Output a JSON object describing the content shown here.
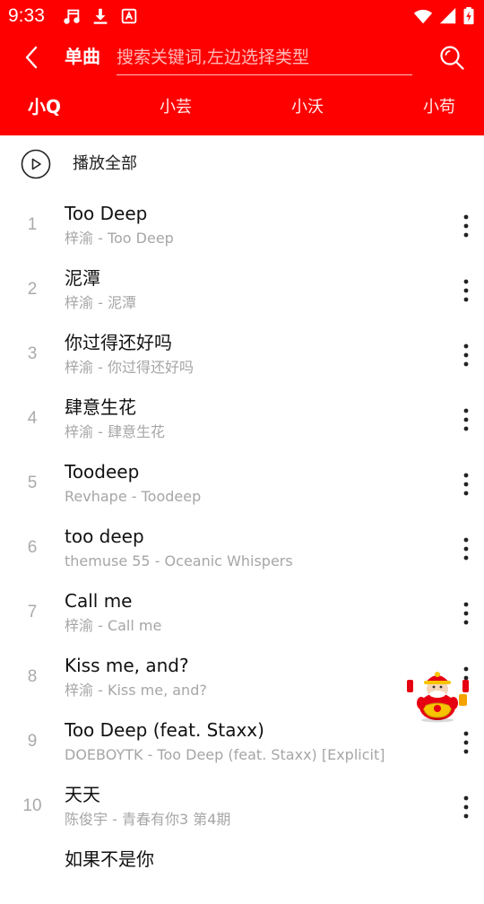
{
  "colors": {
    "primary": "#ff0000",
    "on_primary": "#ffffff",
    "text_primary": "#111111",
    "text_secondary": "#a6a6a6",
    "index_text": "#aaaaaa"
  },
  "status_bar": {
    "time": "9:33",
    "icons": [
      "music-note-icon",
      "download-icon",
      "app-badge-icon",
      "wifi-icon",
      "cellular-signal-icon",
      "battery-icon"
    ]
  },
  "toolbar": {
    "back_icon": "chevron-left-icon",
    "title": "单曲",
    "search_placeholder": "搜索关键词,左边选择类型",
    "search_icon": "search-icon"
  },
  "tabs": [
    {
      "label": "小Q",
      "active": true
    },
    {
      "label": "小芸",
      "active": false
    },
    {
      "label": "小沃",
      "active": false
    },
    {
      "label": "小苟",
      "active": false
    }
  ],
  "play_all": {
    "icon": "play-circle-icon",
    "label": "播放全部"
  },
  "songs": [
    {
      "index": "1",
      "title": "Too Deep",
      "subtitle": "梓渝 - Too Deep"
    },
    {
      "index": "2",
      "title": "泥潭",
      "subtitle": "梓渝 - 泥潭"
    },
    {
      "index": "3",
      "title": "你过得还好吗",
      "subtitle": "梓渝 - 你过得还好吗"
    },
    {
      "index": "4",
      "title": "肆意生花",
      "subtitle": "梓渝 - 肆意生花"
    },
    {
      "index": "5",
      "title": "Toodeep",
      "subtitle": "Revhape - Toodeep"
    },
    {
      "index": "6",
      "title": "too deep",
      "subtitle": "themuse 55 - Oceanic Whispers"
    },
    {
      "index": "7",
      "title": "Call me",
      "subtitle": "梓渝 - Call me"
    },
    {
      "index": "8",
      "title": "Kiss me, and?",
      "subtitle": "梓渝 - Kiss me, and?"
    },
    {
      "index": "9",
      "title": "Too Deep (feat. Staxx)",
      "subtitle": "DOEBOYTK - Too Deep (feat. Staxx) [Explicit]"
    },
    {
      "index": "10",
      "title": "天天",
      "subtitle": "陈俊宇 - 青春有你3 第4期"
    },
    {
      "index": "",
      "title": "如果不是你",
      "subtitle": ""
    }
  ],
  "floating_mascot": {
    "icon": "lucky-god-mascot-icon"
  }
}
